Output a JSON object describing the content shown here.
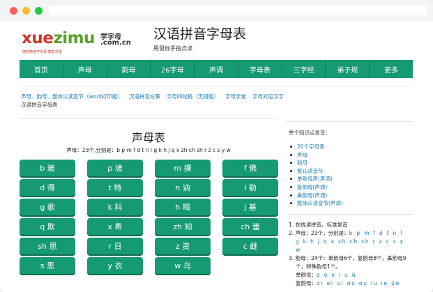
{
  "logo": {
    "xue": "xue",
    "zimu": "zimu",
    "cn": "学字母",
    "com": ".com.cn",
    "slogan": "随时随地学字母,简单方便"
  },
  "header": {
    "title": "汉语拼音字母表",
    "subtitle": "用鼠标手指点读"
  },
  "nav": [
    "首页",
    "声母",
    "韵母",
    "26字母",
    "声调",
    "字母表",
    "三字经",
    "弟子规",
    "更多"
  ],
  "breadcrumbs": {
    "links": [
      "声母、韵母、整体认读音节（word打印版）",
      "汉语拼音方案",
      "字母四线格（无错版）",
      "字母学堂",
      "字母对应汉字"
    ],
    "current": "汉语拼音字母表"
  },
  "main": {
    "title": "声母表",
    "desc": "声母：23个,分别是：b p m f d t n l g k h j q x zh ch sh r z c s y w"
  },
  "buttons": [
    "b 玻",
    "p 坡",
    "m 摸",
    "f 佛",
    "d 得",
    "t 特",
    "n 讷",
    "l 勒",
    "g 歌",
    "k 科",
    "h 喝",
    "j 基",
    "q 欺",
    "x 希",
    "zh 知",
    "ch 蚩",
    "sh 思",
    "r 日",
    "z 资",
    "c 雌",
    "s 思",
    "y 衣",
    "w 乌"
  ],
  "sidebar": {
    "title": "单个知识点发音：",
    "items": [
      "26个字母表",
      "声母",
      "韵母",
      "整认读音节",
      "单韵母声(声调)",
      "复韵母(声调)",
      "鼻韵母(声调)",
      "整体认读音节(声调)"
    ]
  },
  "info": {
    "l1": "1. 在线读拼音，标准发音",
    "l2": "2. 声母：23个，分别是：",
    "l2_letters": "b  p  m  f  d  t  n  l",
    "l2_letters2": "g  k  h  j  q  x  zh  ch  sh  r  z  c  s  y",
    "l2_letters3": "w",
    "l3": "3. 韵母：24个：单韵母6个，复韵母8个，鼻韵母9",
    "l3b": "个，特殊韵母1个。",
    "single_label": "单韵母：",
    "single": "ɑ  o  e  i  u  ü",
    "complex_label": "复韵母：",
    "complex": "ɑi  ei  ui  ɑo  ou  iu  ie  üe"
  }
}
